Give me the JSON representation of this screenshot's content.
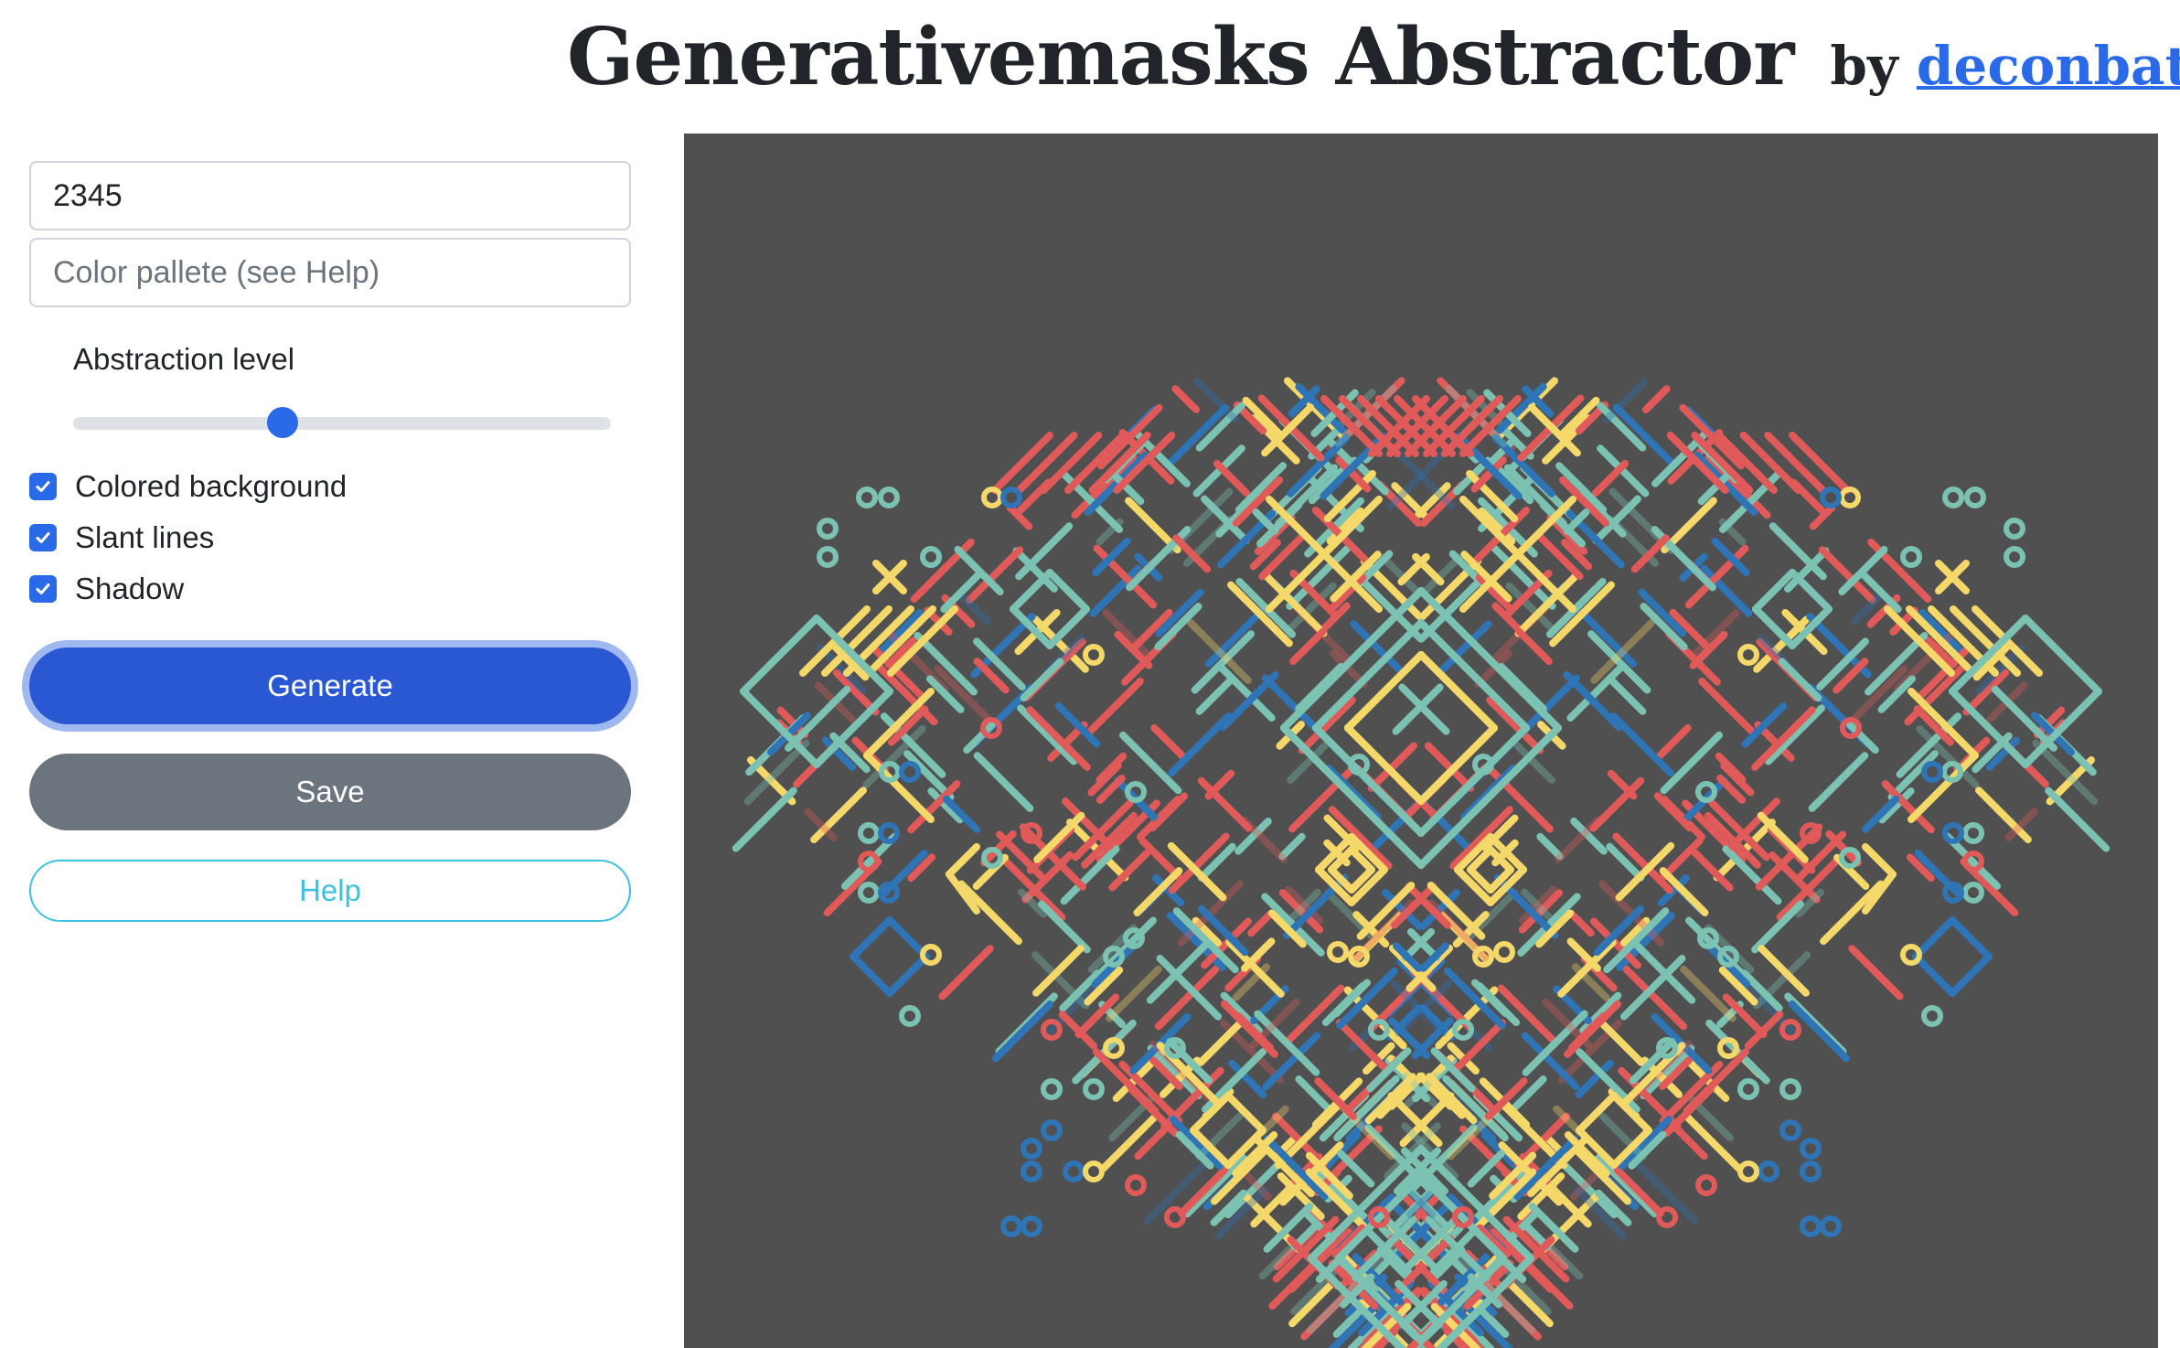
{
  "header": {
    "title": "Generativemasks Abstractor",
    "by_label": "by",
    "author": "deconbatch"
  },
  "controls": {
    "seed_value": "2345",
    "palette_placeholder": "Color pallete (see Help)",
    "abstraction_label": "Abstraction level",
    "abstraction_level": 0.39,
    "checkboxes": [
      {
        "label": "Colored background",
        "checked": true
      },
      {
        "label": "Slant lines",
        "checked": true
      },
      {
        "label": "Shadow",
        "checked": true
      }
    ],
    "generate_label": "Generate",
    "save_label": "Save",
    "help_label": "Help"
  },
  "canvas": {
    "background": "#505050",
    "palette": [
      "#e05a5a",
      "#7cc2b2",
      "#f5d86a",
      "#2f74b5"
    ]
  },
  "colors": {
    "accent": "#2a6ae9",
    "secondary": "#6c757d",
    "info": "#3ec1dc"
  }
}
